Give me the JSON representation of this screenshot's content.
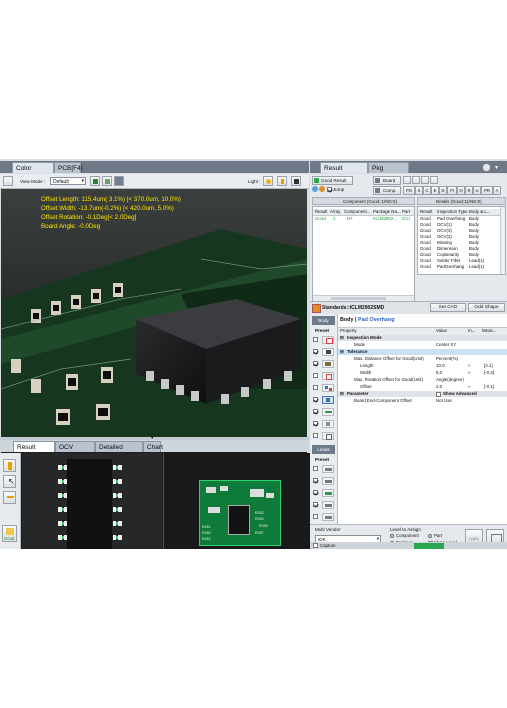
{
  "left_tabs": [
    {
      "label": "Color 3D[F4]"
    },
    {
      "label": "PCB[F4]"
    }
  ],
  "right_tabs": [
    {
      "label": "Result Info[F5]"
    },
    {
      "label": "Pkg Edit[F5]"
    }
  ],
  "toolbar": {
    "view_mode_label": "View Mode :",
    "view_mode_value": "Default",
    "light_label": "Light :"
  },
  "overlay": {
    "line1": "Offset Length: 115.4um(  3.1%) [< 370.0um, 10.0%)",
    "line2": "Offset Width: -13.7um(-0.2%) [< 420.0um,  5.0%)",
    "line3": "Offset Rotation: -0.1Deg[<  2.0Deg]",
    "line4": "Board Angle: -0.0Deg"
  },
  "bottom_tabs": [
    {
      "label": "Result Image"
    },
    {
      "label": "OCV Images"
    },
    {
      "label": "Detailed Result"
    },
    {
      "label": "Chart"
    }
  ],
  "bottom_left": {
    "good_label": "Good"
  },
  "pcb_labels": [
    "R252",
    "R253",
    "R255",
    "R261",
    "R260",
    "R262",
    "R257"
  ],
  "result_panel": {
    "good_result": "Good Result",
    "jump": "Jump",
    "board": "Board",
    "comp": "Comp.",
    "filters": [
      "PO",
      "S",
      "C",
      "E",
      "D",
      "PI",
      "O",
      "R",
      "U",
      "PR",
      "A"
    ],
    "component_title": "Component (Good::1/NG:0)",
    "details_title": "Details (Good:11/NG:0)",
    "comp_headers": [
      "Result",
      "Array",
      "Component...",
      "Package Na...",
      "Part"
    ],
    "comp_rows": [
      [
        "Good",
        "1",
        "N7",
        "ICLM2902...",
        "ICLI"
      ]
    ],
    "detail_headers": [
      "Result",
      "Inspection Type",
      "Body & L..."
    ],
    "detail_rows": [
      [
        "Good",
        "Pad Overhang",
        "Body"
      ],
      [
        "Good",
        "OCV(1)",
        "Body"
      ],
      [
        "Good",
        "OCV(3)",
        "Body"
      ],
      [
        "Good",
        "OCV(2)",
        "Body"
      ],
      [
        "Good",
        "Missing",
        "Body"
      ],
      [
        "Good",
        "Dimension",
        "Body"
      ],
      [
        "Good",
        "Coplanarity",
        "Body"
      ],
      [
        "Good",
        "Solder Fillet",
        "Lead(1)"
      ],
      [
        "Good",
        "PadOverhang",
        "Lead(1)"
      ]
    ]
  },
  "standards": {
    "title": "Standards::ICLM2902SMD",
    "set_cad": "Set CAD",
    "odd_shape": "Odd Shape",
    "body_tab": "Body",
    "preset_label": "Preset",
    "leads_tab": "Leads",
    "preset_label2": "Preset",
    "breadcrumb_body": "Body",
    "breadcrumb_sep": " | ",
    "breadcrumb_item": "Pad Overhang",
    "prop_headers": [
      "Property",
      "Value",
      "In...",
      "Meas..."
    ],
    "rows": [
      {
        "k": "Inspection Mode",
        "v": "",
        "u": "",
        "m": "",
        "section": true
      },
      {
        "k": "Mode",
        "v": "Center XY",
        "u": "",
        "m": ""
      },
      {
        "k": "Tolerance",
        "v": "",
        "u": "",
        "m": "",
        "section": true,
        "selected": true
      },
      {
        "k": "Max. Distance Offset for Good(Unit)",
        "v": "Percent(%)",
        "u": "",
        "m": ""
      },
      {
        "k": "Length",
        "v": "10.0",
        "u": "»",
        "m": "[3.1]"
      },
      {
        "k": "Width",
        "v": "5.0",
        "u": "»",
        "m": "[-0.2]"
      },
      {
        "k": "Max. Rotation Offset for Good(Unit)",
        "v": "Angle(degree)",
        "u": "",
        "m": ""
      },
      {
        "k": "Offset",
        "v": "2.0",
        "u": "»",
        "m": "[-0.1]"
      },
      {
        "k": "Parameter",
        "v": "Show Advanced",
        "u": "",
        "m": "",
        "section": true
      },
      {
        "k": "Board End-Component Offset",
        "v": "Not Use",
        "u": "",
        "m": ""
      }
    ]
  },
  "bottom_right": {
    "multi_vendor": "Multi Vendor",
    "vendor_value": "IDK",
    "level_label": "Level to Assign",
    "opt_component": "Component",
    "opt_part": "Part",
    "opt_package": "Package",
    "show_level": "Show Level",
    "apply": "Apply"
  },
  "capture": "Capture"
}
